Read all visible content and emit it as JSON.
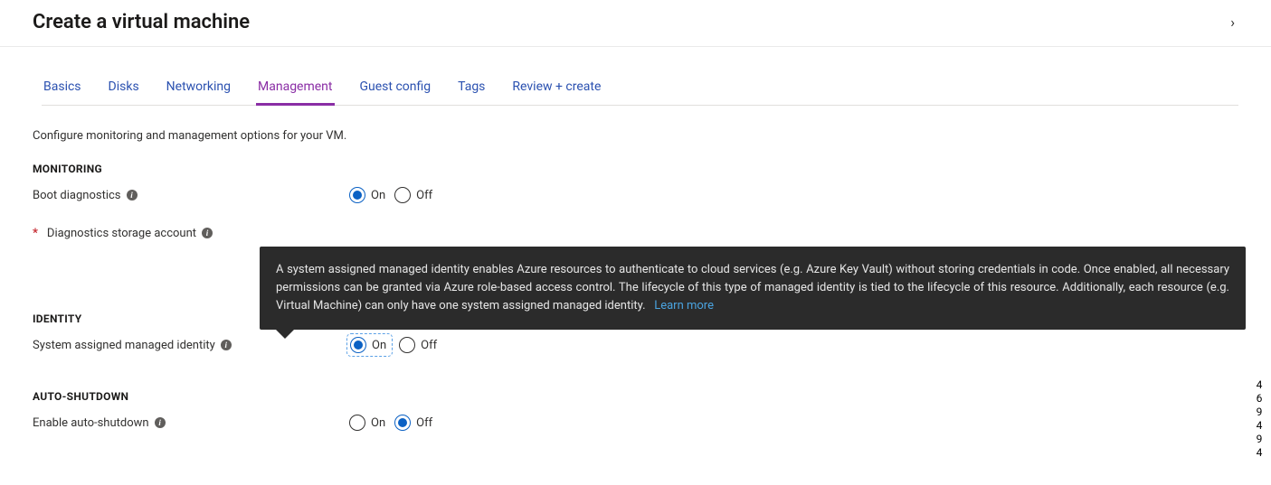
{
  "header": {
    "title": "Create a virtual machine",
    "caret": "›"
  },
  "tabs": [
    {
      "label": "Basics"
    },
    {
      "label": "Disks"
    },
    {
      "label": "Networking"
    },
    {
      "label": "Management",
      "active": true
    },
    {
      "label": "Guest config"
    },
    {
      "label": "Tags"
    },
    {
      "label": "Review + create"
    }
  ],
  "intro": "Configure monitoring and management options for your VM.",
  "sections": {
    "monitoring": {
      "title": "MONITORING",
      "boot_diagnostics": {
        "label": "Boot diagnostics",
        "on": "On",
        "off": "Off",
        "value": "On"
      },
      "diag_storage": {
        "label": "Diagnostics storage account"
      }
    },
    "identity": {
      "title": "IDENTITY",
      "sami": {
        "label": "System assigned managed identity",
        "on": "On",
        "off": "Off",
        "value": "On"
      },
      "tooltip": {
        "text": "A system assigned managed identity enables Azure resources to authenticate to cloud services (e.g. Azure Key Vault) without storing credentials in code. Once enabled, all necessary permissions can be granted via Azure role-based access control. The lifecycle of this type of managed identity is tied to the lifecycle of this resource. Additionally, each resource (e.g. Virtual Machine) can only have one system assigned managed identity.",
        "learn_more": "Learn more"
      }
    },
    "autoshutdown": {
      "title": "AUTO-SHUTDOWN",
      "enable": {
        "label": "Enable auto-shutdown",
        "on": "On",
        "off": "Off",
        "value": "Off"
      }
    }
  },
  "side_number": "469494"
}
